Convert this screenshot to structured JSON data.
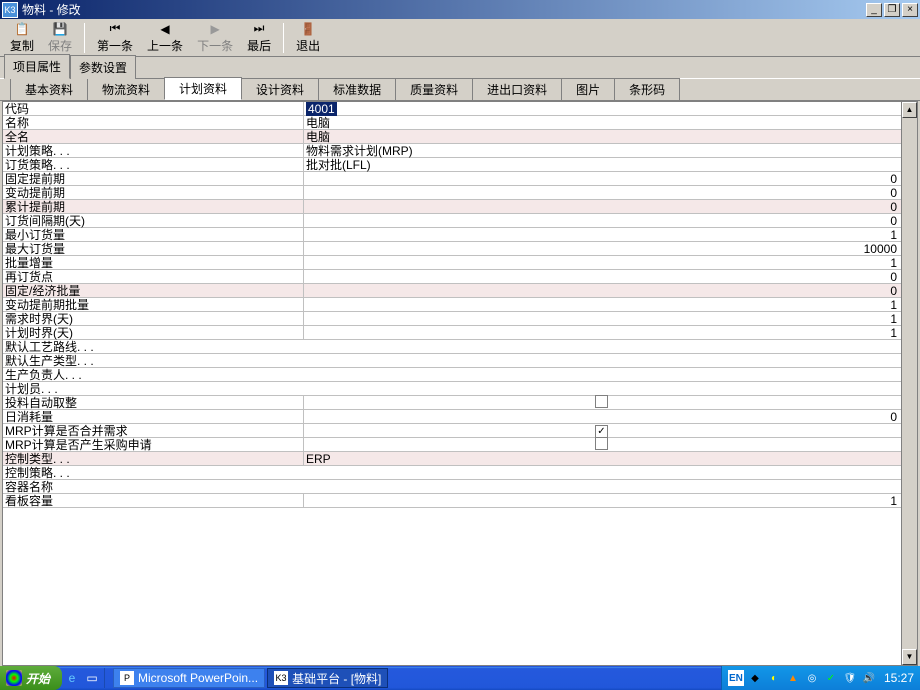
{
  "window": {
    "title": "物料 - 修改"
  },
  "toolbar": {
    "copy": "复制",
    "save": "保存",
    "first": "第一条",
    "prev": "上一条",
    "next": "下一条",
    "last": "最后",
    "exit": "退出"
  },
  "mainTabs": {
    "project": "项目属性",
    "params": "参数设置"
  },
  "subTabs": {
    "basic": "基本资料",
    "logistics": "物流资料",
    "plan": "计划资料",
    "design": "设计资料",
    "standard": "标准数据",
    "quality": "质量资料",
    "importexport": "进出口资料",
    "image": "图片",
    "barcode": "条形码"
  },
  "rows": [
    {
      "label": "代码",
      "value": "4001",
      "type": "selected",
      "shaded": false
    },
    {
      "label": "名称",
      "value": "电脑",
      "type": "text",
      "shaded": false
    },
    {
      "label": "全名",
      "value": "电脑",
      "type": "text",
      "shaded": true
    },
    {
      "label": "计划策略. . .",
      "value": "物料需求计划(MRP)",
      "type": "text",
      "shaded": false
    },
    {
      "label": "订货策略. . .",
      "value": "批对批(LFL)",
      "type": "text",
      "shaded": false
    },
    {
      "label": "固定提前期",
      "value": "0",
      "type": "num",
      "shaded": false
    },
    {
      "label": "变动提前期",
      "value": "0",
      "type": "num",
      "shaded": false
    },
    {
      "label": "累计提前期",
      "value": "0",
      "type": "num",
      "shaded": true
    },
    {
      "label": "订货间隔期(天)",
      "value": "0",
      "type": "num",
      "shaded": false
    },
    {
      "label": "最小订货量",
      "value": "1",
      "type": "num",
      "shaded": false
    },
    {
      "label": "最大订货量",
      "value": "10000",
      "type": "num",
      "shaded": false
    },
    {
      "label": "批量增量",
      "value": "1",
      "type": "num",
      "shaded": false
    },
    {
      "label": "再订货点",
      "value": "0",
      "type": "num",
      "shaded": false
    },
    {
      "label": "固定/经济批量",
      "value": "0",
      "type": "num",
      "shaded": true
    },
    {
      "label": "变动提前期批量",
      "value": "1",
      "type": "num",
      "shaded": false
    },
    {
      "label": "需求时界(天)",
      "value": "1",
      "type": "num",
      "shaded": false
    },
    {
      "label": "计划时界(天)",
      "value": "1",
      "type": "num",
      "shaded": false
    },
    {
      "label": "默认工艺路线. . .",
      "value": "",
      "type": "text",
      "shaded": false
    },
    {
      "label": "默认生产类型. . .",
      "value": "",
      "type": "text",
      "shaded": false
    },
    {
      "label": "生产负责人. . .",
      "value": "",
      "type": "text",
      "shaded": false
    },
    {
      "label": "计划员. . .",
      "value": "",
      "type": "text",
      "shaded": false
    },
    {
      "label": "投料自动取整",
      "value": "",
      "type": "check",
      "checked": false,
      "shaded": false
    },
    {
      "label": "日消耗量",
      "value": "0",
      "type": "num",
      "shaded": false
    },
    {
      "label": "MRP计算是否合并需求",
      "value": "",
      "type": "check",
      "checked": true,
      "shaded": false
    },
    {
      "label": "MRP计算是否产生采购申请",
      "value": "",
      "type": "check",
      "checked": false,
      "shaded": false
    },
    {
      "label": "控制类型. . .",
      "value": "ERP",
      "type": "text",
      "shaded": true
    },
    {
      "label": "控制策略. . .",
      "value": "",
      "type": "text",
      "shaded": false
    },
    {
      "label": "容器名称",
      "value": "",
      "type": "text",
      "shaded": false
    },
    {
      "label": "看板容量",
      "value": "1",
      "type": "num",
      "shaded": false
    }
  ],
  "taskbar": {
    "start": "开始",
    "tasks": [
      {
        "icon": "P",
        "label": "Microsoft PowerPoin..."
      },
      {
        "icon": "K3",
        "label": "基础平台 - [物料]"
      }
    ],
    "ime": "EN",
    "time": "15:27"
  }
}
